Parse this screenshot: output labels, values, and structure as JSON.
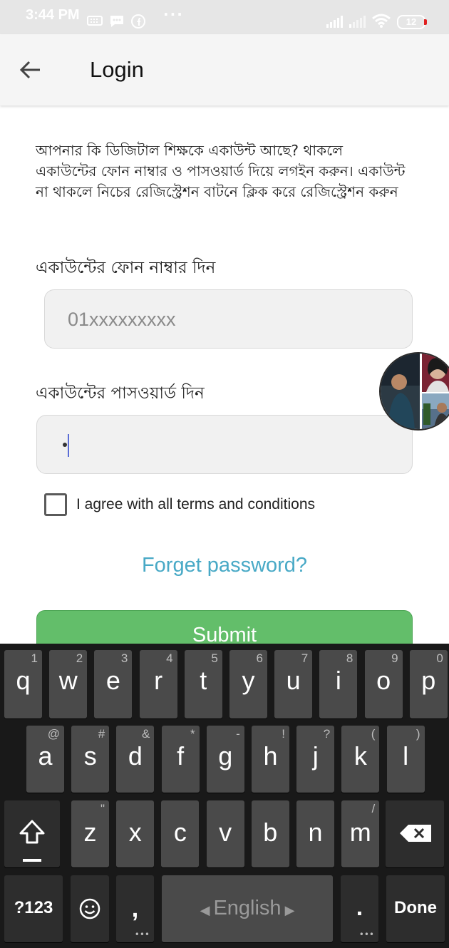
{
  "status_bar": {
    "time": "3:44 PM",
    "battery": "12"
  },
  "app_bar": {
    "title": "Login",
    "back_icon": "arrow-left-icon"
  },
  "intro_text": "আপনার কি ডিজিটাল শিক্ষকে একাউন্ট আছে? থাকলে একাউন্টের ফোন নাম্বার ও পাসওয়ার্ড দিয়ে লগইন করুন। একাউন্ট না থাকলে নিচের রেজিস্ট্রেশন বাটনে ক্লিক করে রেজিস্ট্রেশন করুন",
  "phone": {
    "label": "একাউন্টের ফোন নাম্বার দিন",
    "placeholder": "01xxxxxxxxx"
  },
  "password": {
    "label": "একাউন্টের পাসওয়ার্ড দিন"
  },
  "terms_label": "I agree with all terms and conditions",
  "forget_password": "Forget password?",
  "submit_label": "Submit",
  "colors": {
    "accent_link": "#48a9c6",
    "submit_green": "#63be6a",
    "keyboard_bg": "#191919"
  },
  "keyboard": {
    "row1": [
      {
        "k": "q",
        "h": "1"
      },
      {
        "k": "w",
        "h": "2"
      },
      {
        "k": "e",
        "h": "3"
      },
      {
        "k": "r",
        "h": "4"
      },
      {
        "k": "t",
        "h": "5"
      },
      {
        "k": "y",
        "h": "6"
      },
      {
        "k": "u",
        "h": "7"
      },
      {
        "k": "i",
        "h": "8"
      },
      {
        "k": "o",
        "h": "9"
      },
      {
        "k": "p",
        "h": "0"
      }
    ],
    "row2": [
      {
        "k": "a",
        "h": "@"
      },
      {
        "k": "s",
        "h": "#"
      },
      {
        "k": "d",
        "h": "&"
      },
      {
        "k": "f",
        "h": "*"
      },
      {
        "k": "g",
        "h": "-"
      },
      {
        "k": "h",
        "h": "!"
      },
      {
        "k": "j",
        "h": "?"
      },
      {
        "k": "k",
        "h": "("
      },
      {
        "k": "l",
        "h": ")"
      }
    ],
    "row3": [
      {
        "k": "z",
        "h": "\""
      },
      {
        "k": "x",
        "h": ""
      },
      {
        "k": "c",
        "h": ""
      },
      {
        "k": "v",
        "h": ""
      },
      {
        "k": "b",
        "h": ""
      },
      {
        "k": "n",
        "h": ""
      },
      {
        "k": "m",
        "h": "/"
      }
    ],
    "symbols_label": "?123",
    "comma": ",",
    "space_label": "English",
    "period": ".",
    "done_label": "Done"
  }
}
